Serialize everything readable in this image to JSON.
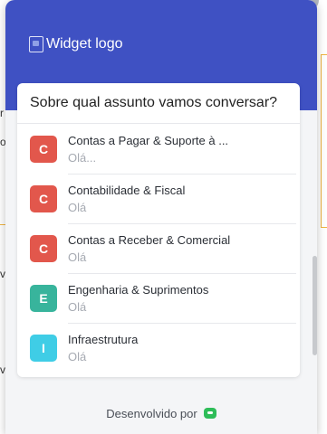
{
  "widget": {
    "logo_alt": "Widget logo",
    "title": "Sobre qual assunto vamos conversar?",
    "items": [
      {
        "letter": "C",
        "name": "Contas a Pagar & Suporte à ...",
        "msg": "Olá...",
        "color": "#e2574c"
      },
      {
        "letter": "C",
        "name": "Contabilidade & Fiscal",
        "msg": "Olá",
        "color": "#e2574c"
      },
      {
        "letter": "C",
        "name": "Contas a Receber & Comercial",
        "msg": "Olá",
        "color": "#e2574c"
      },
      {
        "letter": "E",
        "name": "Engenharia & Suprimentos",
        "msg": "Olá",
        "color": "#38b49c"
      },
      {
        "letter": "I",
        "name": "Infraestrutura",
        "msg": "Olá",
        "color": "#3fcde6"
      }
    ],
    "footer_label": "Desenvolvido por"
  },
  "background": {
    "fragments": [
      {
        "text": "r"
      },
      {
        "text": "o"
      },
      {
        "text": "ve"
      },
      {
        "text": "ve"
      }
    ]
  },
  "colors": {
    "header": "#3f51c3",
    "card": "#ffffff",
    "accent_green": "#2ebd59"
  }
}
